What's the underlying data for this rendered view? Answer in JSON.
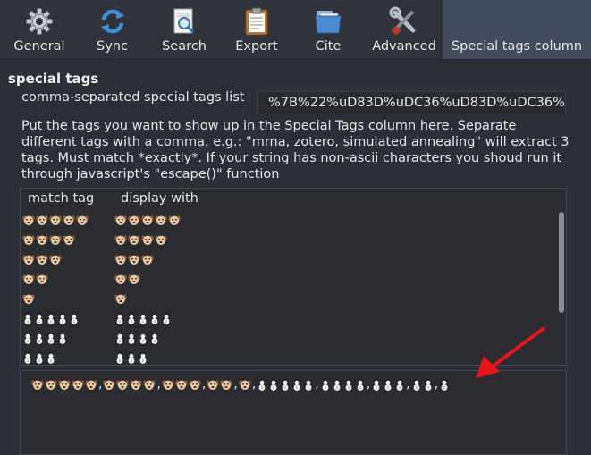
{
  "toolbar": {
    "tabs": [
      {
        "label": "General",
        "icon": "gear-icon"
      },
      {
        "label": "Sync",
        "icon": "sync-icon"
      },
      {
        "label": "Search",
        "icon": "search-icon"
      },
      {
        "label": "Export",
        "icon": "clipboard-icon"
      },
      {
        "label": "Cite",
        "icon": "folder-icon"
      },
      {
        "label": "Advanced",
        "icon": "tools-icon"
      },
      {
        "label": "Special tags column",
        "icon": "none",
        "active": true
      }
    ]
  },
  "section": {
    "title": "special tags",
    "field_label": "comma-separated special tags list",
    "field_value": "%7B%22%uD83D%uDC36%uD83D%uDC36%",
    "description": "Put the tags you want to show up in the Special Tags column here. Separate different tags with a comma, e.g.: \"mrna, zotero, simulated annealing\" will extract 3 tags. Must match *exactly*. If your string has non-ascii characters you shoud run it through javascript's \"escape()\" function"
  },
  "table": {
    "columns": [
      "match tag",
      "display with"
    ],
    "rows": [
      {
        "match": "🐶🐶🐶🐶🐶",
        "display": "🐶🐶🐶🐶🐶"
      },
      {
        "match": "🐶🐶🐶🐶",
        "display": "🐶🐶🐶🐶"
      },
      {
        "match": "🐶🐶🐶",
        "display": "🐶🐶🐶"
      },
      {
        "match": "🐶🐶",
        "display": "🐶🐶"
      },
      {
        "match": "🐶",
        "display": "🐶"
      },
      {
        "match": "⛄⛄⛄⛄⛄",
        "display": "⛄⛄⛄⛄⛄"
      },
      {
        "match": "⛄⛄⛄⛄",
        "display": "⛄⛄⛄⛄"
      },
      {
        "match": "⛄⛄⛄",
        "display": "⛄⛄⛄"
      }
    ]
  },
  "output": {
    "text": "🐶🐶🐶🐶🐶,🐶🐶🐶🐶,🐶🐶🐶,🐶🐶,🐶,⛄⛄⛄⛄⛄,⛄⛄⛄⛄,⛄⛄⛄,⛄⛄,⛄"
  },
  "colors": {
    "background": "#2d2f38",
    "active_tab": "#434c5c",
    "arrow": "#e8141a"
  }
}
